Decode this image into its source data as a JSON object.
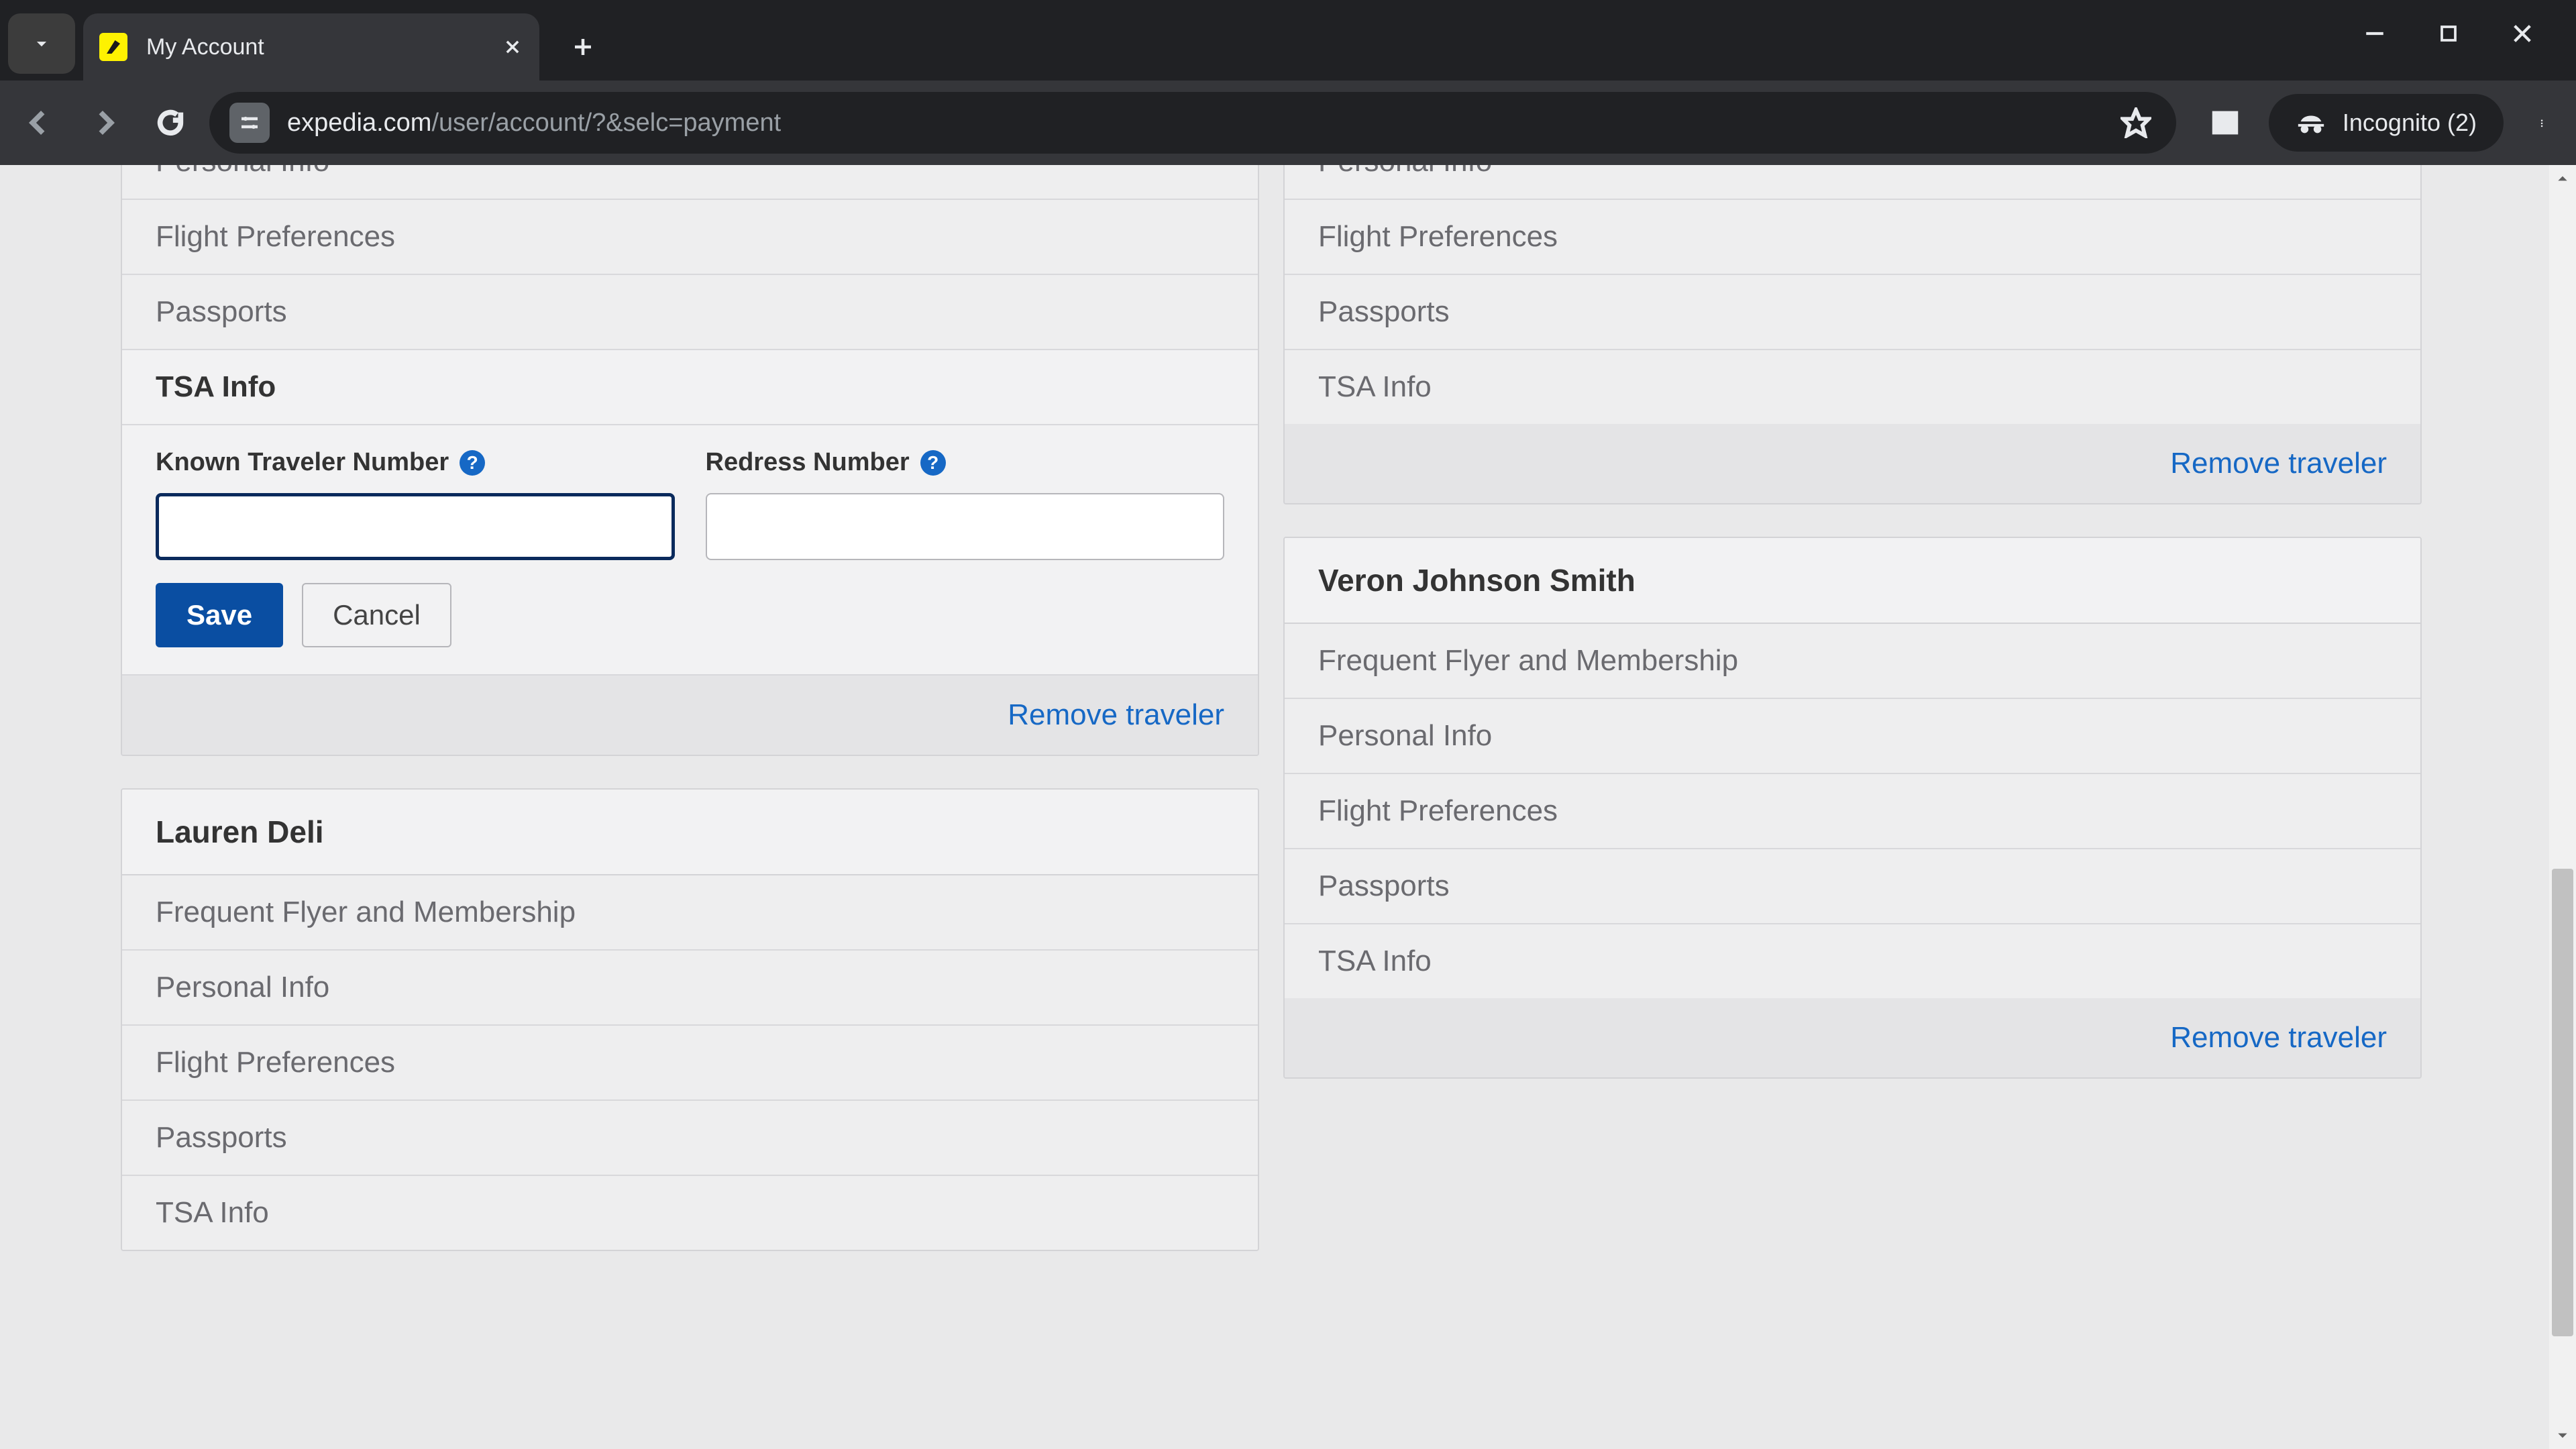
{
  "browser": {
    "tab_title": "My Account",
    "url_host": "expedia.com",
    "url_path": "/user/account/?&selc=payment",
    "incognito_label": "Incognito (2)"
  },
  "sections": {
    "personal_info": "Personal Info",
    "flight_prefs": "Flight Preferences",
    "passports": "Passports",
    "tsa_info": "TSA Info",
    "ffm": "Frequent Flyer and Membership"
  },
  "tsa_form": {
    "ktn_label": "Known Traveler Number",
    "redress_label": "Redress Number",
    "ktn_value": "",
    "redress_value": "",
    "save": "Save",
    "cancel": "Cancel"
  },
  "actions": {
    "remove_traveler": "Remove traveler"
  },
  "travelers": {
    "left_partial_name": "",
    "lauren": "Lauren Deli",
    "right_partial_name": "",
    "veron": "Veron Johnson Smith"
  },
  "help_glyph": "?"
}
